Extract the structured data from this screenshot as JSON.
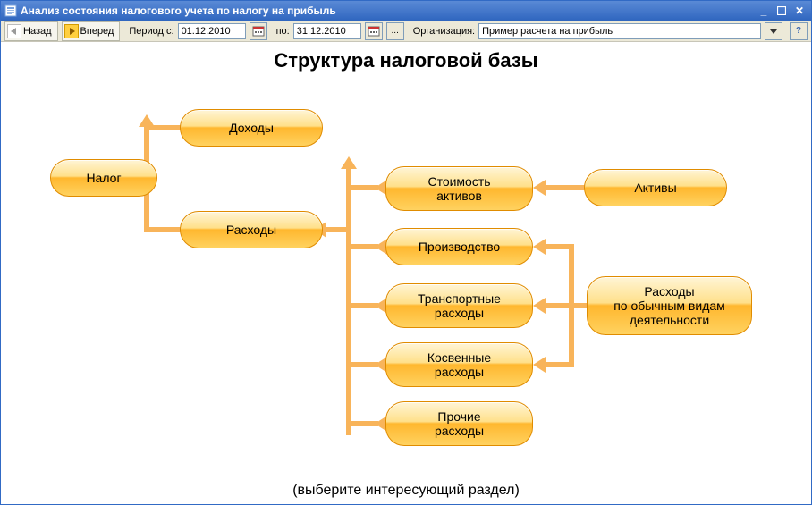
{
  "window": {
    "title": "Анализ состояния налогового учета по налогу на прибыль"
  },
  "toolbar": {
    "back": "Назад",
    "forward": "Вперед",
    "period_label": "Период с:",
    "date_from": "01.12.2010",
    "to_label": "по:",
    "date_to": "31.12.2010",
    "more": "...",
    "org_label": "Организация:",
    "org_value": "Пример расчета на прибыль",
    "help": "?"
  },
  "diagram": {
    "title": "Структура налоговой базы",
    "hint": "(выберите интересующий раздел)",
    "nodes": {
      "tax": "Налог",
      "income": "Доходы",
      "expenses": "Расходы",
      "asset_cost": "Стоимость\nактивов",
      "production": "Производство",
      "transport": "Транспортные\nрасходы",
      "indirect": "Косвенные\nрасходы",
      "other": "Прочие\nрасходы",
      "assets": "Активы",
      "ordinary": "Расходы\nпо обычным видам\nдеятельности"
    }
  }
}
